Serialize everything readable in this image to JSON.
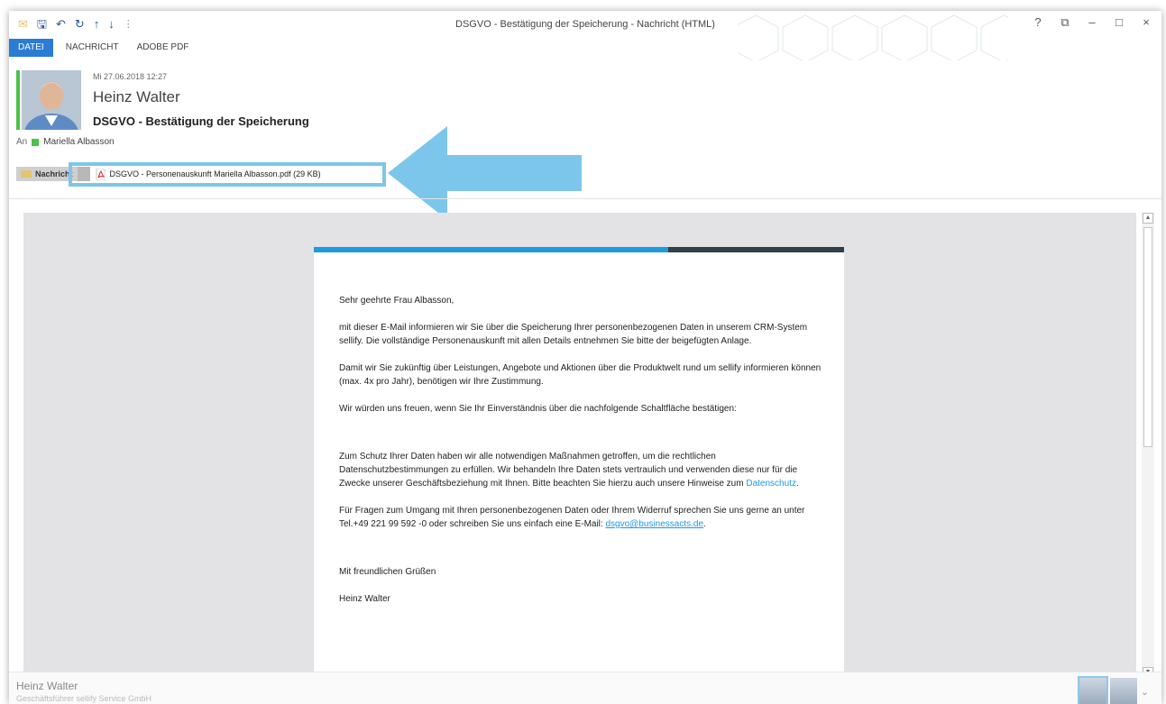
{
  "window": {
    "title": "DSGVO - Bestätigung der Speicherung - Nachricht (HTML)",
    "controls": [
      "?",
      "⧉",
      "–",
      "□",
      "×"
    ]
  },
  "quick_access": [
    "mail-icon",
    "save-icon",
    "undo-icon",
    "redo-icon",
    "arrow-up-icon",
    "arrow-down-icon",
    "customize-icon"
  ],
  "ribbon": {
    "tabs": [
      {
        "label": "DATEI",
        "active": true
      },
      {
        "label": "NACHRICHT",
        "active": false
      },
      {
        "label": "ADOBE PDF",
        "active": false
      }
    ]
  },
  "header": {
    "date": "Mi 27.06.2018 12:27",
    "sender": "Heinz Walter",
    "subject": "DSGVO - Bestätigung der Speicherung",
    "to_label": "An",
    "to_name": "Mariella Albasson"
  },
  "attachments": {
    "message_label": "Nachricht",
    "file": "DSGVO - Personenauskunft Mariella Albasson.pdf (29 KB)"
  },
  "email": {
    "greeting": "Sehr geehrte Frau Albasson,",
    "p1": "mit dieser E-Mail informieren wir Sie über die Speicherung Ihrer personenbezogenen Daten in unserem CRM-System sellify. Die vollständige Personenauskunft mit allen Details entnehmen Sie bitte der beigefügten Anlage.",
    "p2": "Damit wir Sie zukünftig über Leistungen, Angebote und Aktionen über die Produktwelt rund um sellify informieren können (max. 4x pro Jahr), benötigen wir Ihre Zustimmung.",
    "p3": "Wir würden uns freuen, wenn Sie Ihr Einverständnis über die nachfolgende Schaltfläche bestätigen:",
    "p4": "Zum Schutz Ihrer Daten haben wir alle notwendigen Maßnahmen getroffen, um die rechtlichen Datenschutzbestimmungen zu erfüllen. Wir behandeln Ihre Daten stets vertraulich und verwenden diese nur für die Zwecke unserer Geschäftsbeziehung mit Ihnen. Bitte beachten Sie hierzu auch unsere Hinweise zum",
    "p4_link": "Datenschutz",
    "p4_end": ".",
    "p5": "Für Fragen zum Umgang mit Ihren personenbezogenen Daten oder Ihrem Widerruf sprechen Sie uns gerne an unter Tel.+49 221 99 592 -0 oder schreiben Sie uns einfach eine E-Mail:",
    "p5_link": "dsgvo@businessacts.de",
    "p5_end": ".",
    "closing": "Mit freundlichen Grüßen",
    "signature": "Heinz Walter"
  },
  "footer": {
    "name": "Heinz Walter",
    "role": "Geschäftsführer sellify Service GmbH"
  },
  "colors": {
    "accent_blue": "#2b7cd3",
    "green": "#4cc24a",
    "highlight": "#7cc6ec",
    "bar_blue": "#1e9ae0",
    "bar_dark": "#333e4c"
  }
}
